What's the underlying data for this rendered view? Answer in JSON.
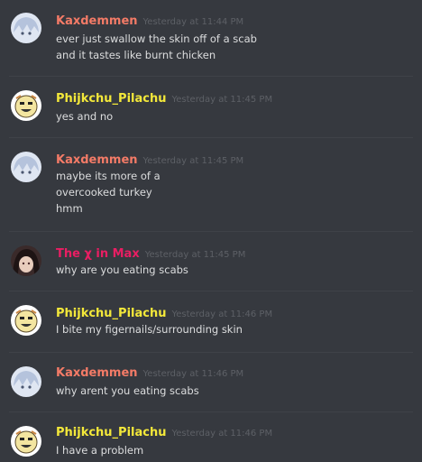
{
  "users": {
    "kax": {
      "name": "Kaxdemmen",
      "color": "#f47b67",
      "avatar_icon": "white-haired-anime-avatar-icon"
    },
    "phi": {
      "name": "Phijkchu_Pilachu",
      "color": "#f3e83a",
      "avatar_icon": "yellow-cartoon-face-avatar-icon"
    },
    "max": {
      "name": "The χ in Max",
      "color": "#e91e63",
      "avatar_icon": "dark-haired-anime-avatar-icon"
    }
  },
  "messages": [
    {
      "user": "Kaxdemmen",
      "time": "Yesterday at 11:44 PM",
      "lines": [
        "ever just swallow the skin off of a scab",
        "and it tastes like burnt chicken"
      ]
    },
    {
      "user": "Phijkchu_Pilachu",
      "time": "Yesterday at 11:45 PM",
      "lines": [
        "yes and no"
      ]
    },
    {
      "user": "Kaxdemmen",
      "time": "Yesterday at 11:45 PM",
      "lines": [
        "maybe its more of a",
        "overcooked turkey",
        "hmm"
      ]
    },
    {
      "user": "The χ in Max",
      "time": "Yesterday at 11:45 PM",
      "lines": [
        "why are you eating scabs"
      ]
    },
    {
      "user": "Phijkchu_Pilachu",
      "time": "Yesterday at 11:46 PM",
      "lines": [
        "I bite my figernails/surrounding skin"
      ]
    },
    {
      "user": "Kaxdemmen",
      "time": "Yesterday at 11:46 PM",
      "lines": [
        "why arent you eating scabs"
      ]
    },
    {
      "user": "Phijkchu_Pilachu",
      "time": "Yesterday at 11:46 PM",
      "lines": [
        "I have a problem"
      ]
    }
  ]
}
